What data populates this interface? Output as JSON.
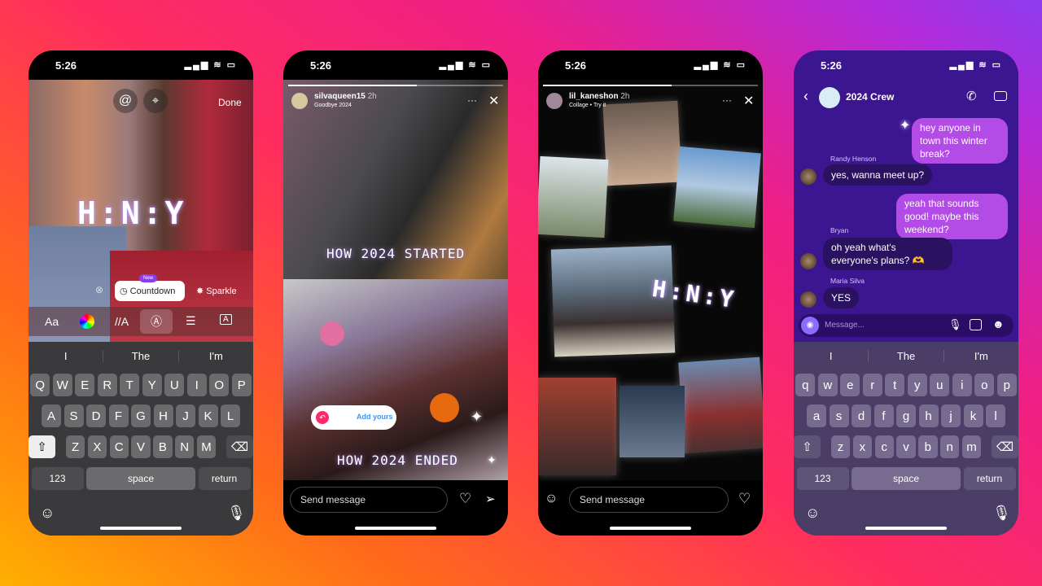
{
  "colors": {
    "bg_pink": "#ff2d5e",
    "bg_orange": "#ffb000",
    "bg_purple": "#8d3cf0",
    "chat_bg": "#3c1590",
    "my_bubble": "#b34be6",
    "their_bubble": "#2a1260"
  },
  "status": {
    "time": "5:26",
    "signal_icon": "signal-icon",
    "wifi_icon": "wifi-icon",
    "battery_icon": "battery-icon"
  },
  "phone1": {
    "done": "Done",
    "mention_icon": "at-icon",
    "location_icon": "location-pin-icon",
    "sticker_text": "H:N:Y",
    "effects": {
      "new_badge": "New",
      "countdown": "Countdown",
      "sparkle": "Sparkle"
    },
    "toolbar": {
      "font": "Aa",
      "color": "color-wheel-icon",
      "animation": "//A",
      "effect": "effect-icon",
      "align": "align-center-icon",
      "background": "A"
    }
  },
  "phone2": {
    "username": "silvaqueen15",
    "time": "2h",
    "subtitle": "Goodbye 2024",
    "caption_top": "HOW 2024 STARTED",
    "caption_bottom": "HOW 2024 ENDED",
    "add_yours": "Add yours",
    "send_placeholder": "Send message",
    "progress": 0.6
  },
  "phone3": {
    "username": "lil_kaneshon",
    "time": "2h",
    "subtitle": "Collage • Try it",
    "sticker_text": "H:N:Y",
    "send_placeholder": "Send message",
    "progress": 0.6
  },
  "phone4": {
    "title": "2024 Crew",
    "message_placeholder": "Message...",
    "messages": [
      {
        "from": "me",
        "text": "hey anyone in town this winter break?"
      },
      {
        "from": "Randy Henson",
        "text": "yes, wanna meet up?"
      },
      {
        "from": "me",
        "text": "yeah that sounds good! maybe this weekend?"
      },
      {
        "from": "Bryan",
        "text": "oh yeah what's everyone's plans? 🫶"
      },
      {
        "from": "Maria Silva",
        "text": "YES"
      }
    ]
  },
  "keyboard": {
    "suggestions": [
      "I",
      "The",
      "I'm"
    ],
    "rows_upper": [
      [
        "Q",
        "W",
        "E",
        "R",
        "T",
        "Y",
        "U",
        "I",
        "O",
        "P"
      ],
      [
        "A",
        "S",
        "D",
        "F",
        "G",
        "H",
        "J",
        "K",
        "L"
      ],
      [
        "Z",
        "X",
        "C",
        "V",
        "B",
        "N",
        "M"
      ]
    ],
    "rows_lower": [
      [
        "q",
        "w",
        "e",
        "r",
        "t",
        "y",
        "u",
        "i",
        "o",
        "p"
      ],
      [
        "a",
        "s",
        "d",
        "f",
        "g",
        "h",
        "j",
        "k",
        "l"
      ],
      [
        "z",
        "x",
        "c",
        "v",
        "b",
        "n",
        "m"
      ]
    ],
    "numbers": "123",
    "space": "space",
    "return": "return"
  }
}
